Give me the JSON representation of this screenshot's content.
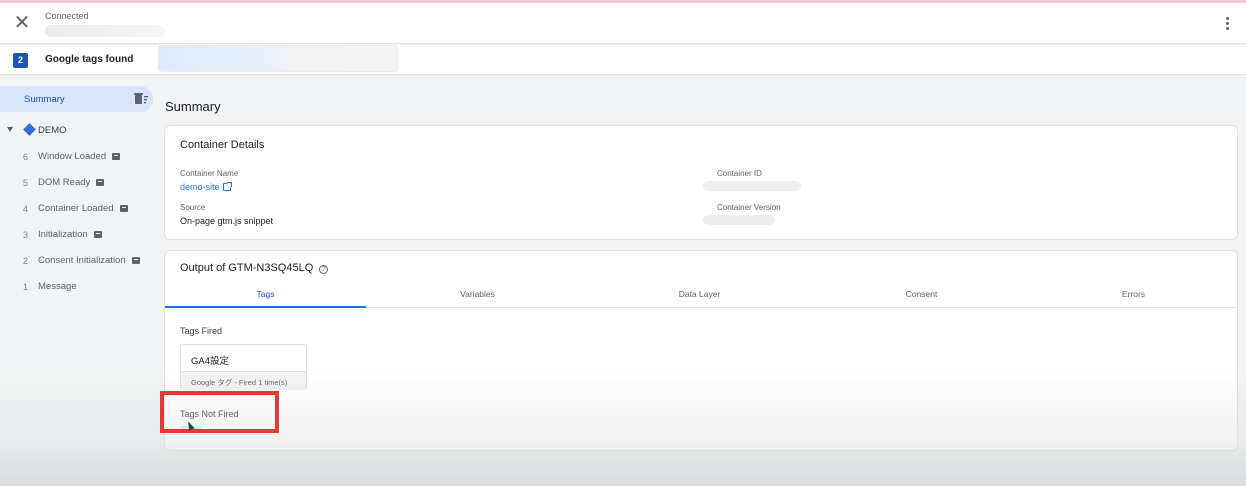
{
  "header": {
    "status": "Connected",
    "close_icon": "close-icon",
    "menu_icon": "more-vert-icon"
  },
  "tags_bar": {
    "count": "2",
    "label": "Google tags found"
  },
  "sidebar": {
    "summary_label": "Summary",
    "summary_icon": "delete-sweep-icon",
    "container_label": "DEMO",
    "events": [
      {
        "num": "6",
        "label": "Window Loaded",
        "has_icon": true
      },
      {
        "num": "5",
        "label": "DOM Ready",
        "has_icon": true
      },
      {
        "num": "4",
        "label": "Container Loaded",
        "has_icon": true
      },
      {
        "num": "3",
        "label": "Initialization",
        "has_icon": true
      },
      {
        "num": "2",
        "label": "Consent Initialization",
        "has_icon": true
      },
      {
        "num": "1",
        "label": "Message",
        "has_icon": false
      }
    ]
  },
  "main": {
    "title": "Summary",
    "container_details": {
      "title": "Container Details",
      "name_label": "Container Name",
      "name_value": "demo-site",
      "id_label": "Container ID",
      "source_label": "Source",
      "source_value": "On-page gtm.js snippet",
      "version_label": "Container Version"
    },
    "output": {
      "title": "Output of GTM-N3SQ45LQ",
      "tabs": [
        "Tags",
        "Variables",
        "Data Layer",
        "Consent",
        "Errors"
      ],
      "active_tab": "Tags",
      "tags_fired_label": "Tags Fired",
      "fired_tags": [
        {
          "name": "GA4設定",
          "meta": "Google タグ - Fired 1 time(s)"
        }
      ],
      "tags_not_fired_label": "Tags Not Fired"
    }
  },
  "colors": {
    "accent": "#1a73e8",
    "highlight": "#e53935",
    "badge": "#1a56b8"
  }
}
